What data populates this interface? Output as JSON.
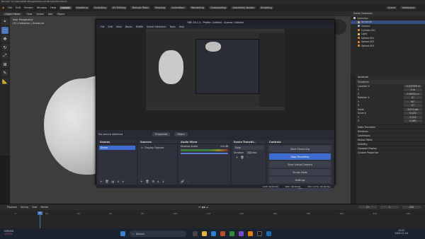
{
  "window": {
    "title": "Blender* [C:\\Users\\WDT-PS\\AppData\\Local\\Temp\\buffer.blend]"
  },
  "menubar": {
    "menus": [
      "File",
      "Edit",
      "Render",
      "Window",
      "Help"
    ],
    "workspaces": [
      "Layout",
      "Modeling",
      "Sculpting",
      "UV Editing",
      "Texture Paint",
      "Shading",
      "Animation",
      "Rendering",
      "Compositing",
      "Geometry Nodes",
      "Scripting"
    ],
    "scene": "Scene",
    "view_layer": "ViewLayer"
  },
  "header": {
    "mode": "Object Mode",
    "items": [
      "View",
      "Select",
      "Add",
      "Object"
    ],
    "orientation": "Global",
    "orient_label": "Orientation:",
    "drag": "Select Box",
    "drag_label": "Drag:",
    "pivot": "Default"
  },
  "viewport": {
    "line1": "User Perspective",
    "line2": "(21) Collection | Armature"
  },
  "outliner": {
    "title": "Scene Collection",
    "items": [
      {
        "label": "Collection",
        "color": "#cccccc",
        "selected": false
      },
      {
        "label": "Armature",
        "color": "#e0a95a",
        "selected": true
      },
      {
        "label": "Camera",
        "color": "#8cb4e0",
        "selected": false
      },
      {
        "label": "Cylinder.001",
        "color": "#e08a3a",
        "selected": false
      },
      {
        "label": "Light",
        "color": "#e0d15a",
        "selected": false
      },
      {
        "label": "Sphere.001",
        "color": "#e08a3a",
        "selected": false
      },
      {
        "label": "Sphere.002",
        "color": "#e08a3a",
        "selected": false
      },
      {
        "label": "Sphere.003",
        "color": "#e08a3a",
        "selected": false
      }
    ]
  },
  "properties": {
    "object": "Armature",
    "section": "Transform",
    "fields": [
      {
        "label": "Location X",
        "value": "-0.047359 m"
      },
      {
        "label": "Y",
        "value": "0 m"
      },
      {
        "label": "Z",
        "value": "0.96921 m"
      },
      {
        "label": "Rotation X",
        "value": "0°"
      },
      {
        "label": "Y",
        "value": "90°"
      },
      {
        "label": "Z",
        "value": "0°"
      },
      {
        "label": "Mode",
        "value": "XYZ Euler"
      },
      {
        "label": "Scale X",
        "value": "0.223"
      },
      {
        "label": "Y",
        "value": "0.223"
      },
      {
        "label": "Z",
        "value": "0.083"
      }
    ],
    "panels": [
      "Delta Transform",
      "Relations",
      "Collections",
      "Motion Paths",
      "Visibility",
      "Viewport Display",
      "Custom Properties"
    ]
  },
  "timeline": {
    "menus": [
      "Playback",
      "Keying",
      "View",
      "Marker"
    ],
    "frame": "21",
    "start": "1",
    "end": "250",
    "ticks": [
      "0",
      "20",
      "40",
      "60",
      "80",
      "100",
      "120",
      "140",
      "160",
      "180",
      "200",
      "220",
      "240"
    ]
  },
  "obs": {
    "title": "OBS 29.1.3 - Profile: Untitled - Scenes: Untitled",
    "menu": [
      "File",
      "Edit",
      "View",
      "Docks",
      "Profile",
      "Scene Collection",
      "Tools",
      "Help"
    ],
    "no_source": "No source selected",
    "props_btn": "Properties",
    "filters_btn": "Filters",
    "docks": {
      "scenes": {
        "title": "Scenes",
        "item": "Scene"
      },
      "sources": {
        "title": "Sources",
        "item": "Display Capture"
      },
      "mixer": {
        "title": "Audio Mixer",
        "channel": "Desktop Audio",
        "db": "0.0 dB"
      },
      "transitions": {
        "title": "Scene Transiti...",
        "type": "Fade",
        "duration_label": "Duration",
        "duration": "300 ms"
      },
      "controls": {
        "title": "Controls",
        "buttons": [
          "Start Streaming",
          "Stop Recording",
          "Start Virtual Camera",
          "Studio Mode",
          "Settings",
          "Exit"
        ]
      }
    },
    "status": {
      "live": "LIVE: 00:00:00",
      "rec": "REC: 00:00:00",
      "cpu": "CPU: 0.0%, 60.00 fps"
    }
  },
  "taskbar": {
    "weather_temp": "EURUSD",
    "weather_desc": "-0.07%",
    "search": "Search",
    "time": "15:52",
    "date": "2023-11-04"
  },
  "colors": {
    "accent": "#4772b3",
    "obs_rec": "#3d6dd1"
  }
}
